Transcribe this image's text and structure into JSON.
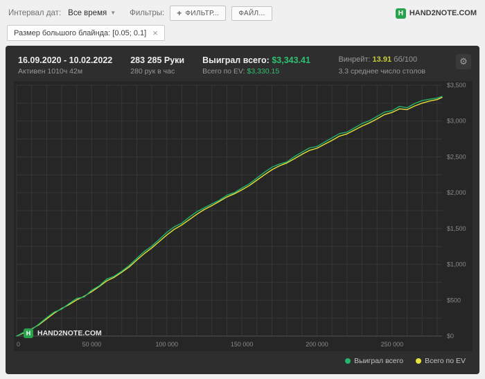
{
  "topbar": {
    "date_interval_label": "Интервал дат:",
    "date_interval_value": "Все время",
    "filters_label": "Фильтры:",
    "filter_button": "ФИЛЬТР...",
    "file_button": "ФАЙЛ...",
    "brand": "HAND2NOTE.COM",
    "brand_letter": "H"
  },
  "filter_chip": {
    "text": "Размер большого блайнда: [0.05; 0.1]",
    "close_icon": "×"
  },
  "stats": {
    "date_range": "16.09.2020 - 10.02.2022",
    "active_time": "Активен 1010ч 42м",
    "hands": "283 285 Руки",
    "hands_per_hour": "280 рук в час",
    "won_label": "Выиграл всего:",
    "won_value": "$3,343.41",
    "ev_label": "Всего по EV:",
    "ev_value": "$3,330.15",
    "winrate_label": "Винрейт:",
    "winrate_value": "13.91",
    "winrate_unit": "бб/100",
    "avg_tables": "3.3 среднее число столов",
    "gear_icon": "⚙"
  },
  "watermark": {
    "text": "HAND2NOTE.COM",
    "letter": "H"
  },
  "legend": [
    {
      "label": "Выиграл всего",
      "color": "#22b66e"
    },
    {
      "label": "Всего по EV",
      "color": "#e6e33c"
    }
  ],
  "colors": {
    "green": "#22b66e",
    "yellow": "#e6e33c",
    "panel_bg": "#2e2e2e",
    "plot_bg": "#262626",
    "grid": "#373737",
    "baseline": "#525252",
    "tick_text": "#8a8a8a"
  },
  "chart_data": {
    "type": "line",
    "title": "",
    "xlabel": "hands",
    "ylabel": "USD",
    "xlim": [
      0,
      283285
    ],
    "ylim": [
      0,
      3500
    ],
    "x_grid_step": 10000,
    "y_grid_step": 250,
    "grid": true,
    "legend_position": "bottom-right",
    "x_ticks": [
      {
        "value": 0,
        "label": "0"
      },
      {
        "value": 50000,
        "label": "50 000"
      },
      {
        "value": 100000,
        "label": "100 000"
      },
      {
        "value": 150000,
        "label": "150 000"
      },
      {
        "value": 200000,
        "label": "200 000"
      },
      {
        "value": 250000,
        "label": "250 000"
      }
    ],
    "y_ticks": [
      {
        "value": 0,
        "label": "$0"
      },
      {
        "value": 500,
        "label": "$500"
      },
      {
        "value": 1000,
        "label": "$1,000"
      },
      {
        "value": 1500,
        "label": "$1,500"
      },
      {
        "value": 2000,
        "label": "$2,000"
      },
      {
        "value": 2500,
        "label": "$2,500"
      },
      {
        "value": 3000,
        "label": "$3,000"
      },
      {
        "value": 3500,
        "label": "$3,500"
      }
    ],
    "x": [
      0,
      5000,
      10000,
      15000,
      20000,
      25000,
      30000,
      35000,
      40000,
      45000,
      50000,
      55000,
      60000,
      65000,
      70000,
      75000,
      80000,
      85000,
      90000,
      95000,
      100000,
      105000,
      110000,
      115000,
      120000,
      125000,
      130000,
      135000,
      140000,
      145000,
      150000,
      155000,
      160000,
      165000,
      170000,
      175000,
      180000,
      185000,
      190000,
      195000,
      200000,
      205000,
      210000,
      215000,
      220000,
      225000,
      230000,
      235000,
      240000,
      245000,
      250000,
      255000,
      260000,
      265000,
      270000,
      275000,
      280000,
      283285
    ],
    "series": [
      {
        "name": "Выиграл всего",
        "color": "#22b66e",
        "values": [
          0,
          55,
          90,
          170,
          255,
          335,
          375,
          455,
          525,
          545,
          640,
          700,
          795,
          835,
          905,
          985,
          1085,
          1180,
          1255,
          1350,
          1445,
          1525,
          1575,
          1660,
          1735,
          1790,
          1845,
          1895,
          1965,
          2000,
          2065,
          2125,
          2205,
          2285,
          2355,
          2400,
          2430,
          2505,
          2565,
          2625,
          2645,
          2705,
          2765,
          2825,
          2845,
          2905,
          2965,
          3005,
          3065,
          3125,
          3145,
          3205,
          3185,
          3245,
          3285,
          3305,
          3320,
          3343.41
        ]
      },
      {
        "name": "Всего по EV",
        "color": "#e6e33c",
        "values": [
          0,
          45,
          100,
          160,
          240,
          320,
          385,
          440,
          505,
          555,
          620,
          690,
          770,
          820,
          890,
          965,
          1060,
          1150,
          1230,
          1320,
          1410,
          1490,
          1550,
          1625,
          1700,
          1765,
          1820,
          1880,
          1940,
          1985,
          2040,
          2100,
          2175,
          2250,
          2320,
          2375,
          2415,
          2475,
          2535,
          2590,
          2620,
          2675,
          2730,
          2790,
          2820,
          2875,
          2930,
          2975,
          3030,
          3090,
          3120,
          3170,
          3160,
          3210,
          3250,
          3280,
          3300,
          3330.15
        ]
      }
    ]
  }
}
